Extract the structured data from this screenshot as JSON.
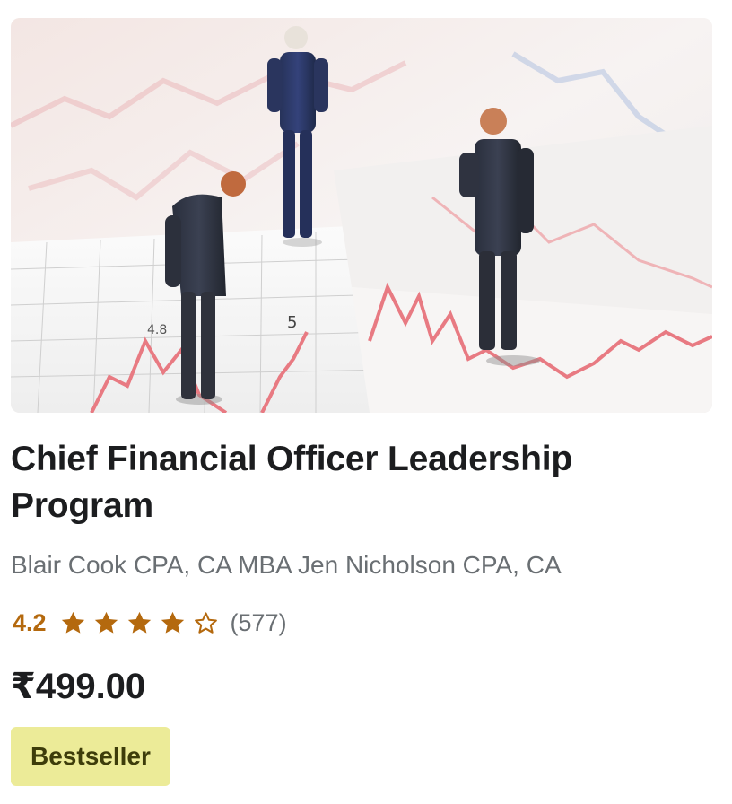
{
  "course": {
    "title": "Chief Financial Officer Leadership Program",
    "instructors": "Blair Cook CPA, CA MBA Jen Nicholson CPA, CA",
    "rating": "4.2",
    "rating_stars": 4.2,
    "star_icons": [
      "star-filled-icon",
      "star-filled-icon",
      "star-filled-icon",
      "star-filled-icon",
      "star-outline-icon"
    ],
    "review_count": "(577)",
    "price": "₹499.00",
    "badge": "Bestseller"
  },
  "colors": {
    "rating": "#b4690e",
    "instructor_text": "#6a6f73",
    "badge_bg": "#eceb98",
    "badge_text": "#3d3c0a",
    "chart_line": "#e87a82"
  }
}
